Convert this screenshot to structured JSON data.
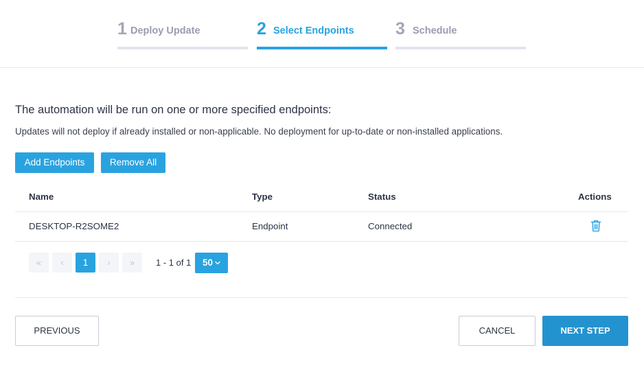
{
  "stepper": {
    "steps": [
      {
        "number": "1",
        "label": "Deploy Update",
        "state": "inactive"
      },
      {
        "number": "2",
        "label": "Select Endpoints",
        "state": "active"
      },
      {
        "number": "3",
        "label": "Schedule",
        "state": "inactive"
      }
    ]
  },
  "content": {
    "heading": "The automation will be run on one or more specified endpoints:",
    "subtext": "Updates will not deploy if already installed or non-applicable. No deployment for up-to-date or non-installed applications.",
    "add_endpoints_label": "Add Endpoints",
    "remove_all_label": "Remove All"
  },
  "table": {
    "headers": {
      "name": "Name",
      "type": "Type",
      "status": "Status",
      "actions": "Actions"
    },
    "rows": [
      {
        "name": "DESKTOP-R2SOME2",
        "type": "Endpoint",
        "status": "Connected",
        "action_icon": "trash-icon"
      }
    ]
  },
  "pagination": {
    "first": "«",
    "prev": "‹",
    "current": "1",
    "next": "›",
    "last": "»",
    "info": "1 - 1 of 1",
    "page_size": "50"
  },
  "footer": {
    "previous_label": "PREVIOUS",
    "cancel_label": "CANCEL",
    "next_label": "NEXT STEP"
  },
  "colors": {
    "accent": "#29a3df",
    "primary_button": "#2393cf",
    "inactive_step": "#a3a6b6"
  }
}
